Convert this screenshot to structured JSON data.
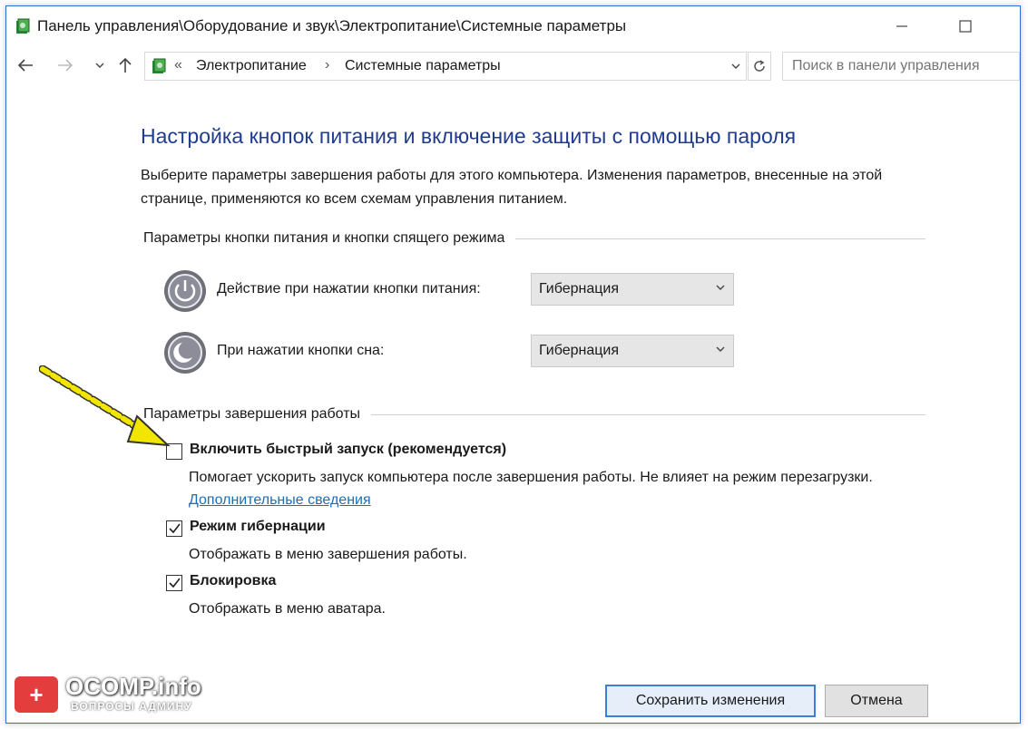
{
  "window": {
    "title": "Панель управления\\Оборудование и звук\\Электропитание\\Системные параметры"
  },
  "nav": {
    "breadcrumb": [
      "Электропитание",
      "Системные параметры"
    ],
    "search_placeholder": "Поиск в панели управления"
  },
  "page": {
    "heading": "Настройка кнопок питания и включение защиты с помощью пароля",
    "description": "Выберите параметры завершения работы для этого компьютера. Изменения параметров, внесенные на этой странице, применяются ко всем схемам управления питанием."
  },
  "power_section": {
    "title": "Параметры кнопки питания и кнопки спящего режима",
    "rows": [
      {
        "label": "Действие при нажатии кнопки питания:",
        "value": "Гибернация",
        "icon": "power-icon"
      },
      {
        "label": "При нажатии кнопки сна:",
        "value": "Гибернация",
        "icon": "sleep-icon"
      }
    ]
  },
  "shutdown_section": {
    "title": "Параметры завершения работы",
    "options": [
      {
        "label": "Включить быстрый запуск (рекомендуется)",
        "checked": false,
        "description": "Помогает ускорить запуск компьютера после завершения работы. Не влияет на режим перезагрузки.",
        "link": "Дополнительные сведения"
      },
      {
        "label": "Режим гибернации",
        "checked": true,
        "description": "Отображать в меню завершения работы."
      },
      {
        "label": "Блокировка",
        "checked": true,
        "description": "Отображать в меню аватара."
      }
    ]
  },
  "buttons": {
    "save": "Сохранить изменения",
    "cancel": "Отмена"
  },
  "watermark": {
    "title": "OCOMP.info",
    "subtitle": "ВОПРОСЫ АДМИНУ"
  },
  "colors": {
    "heading": "#1f3c8f",
    "link": "#1a6fb8",
    "window_border": "#2f6fd6",
    "annotation_arrow": "#f2e600"
  }
}
